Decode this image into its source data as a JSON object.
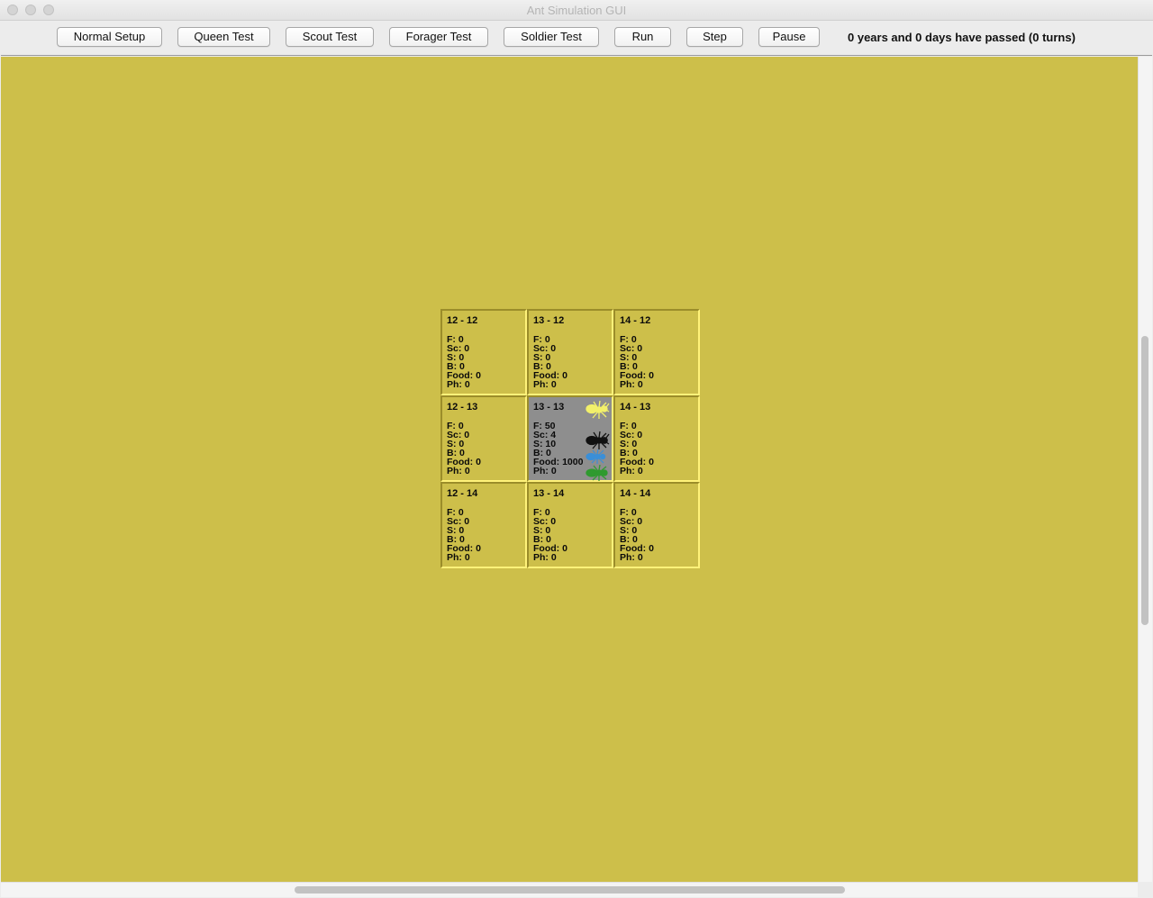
{
  "window": {
    "title": "Ant Simulation GUI"
  },
  "toolbar": {
    "buttons": [
      {
        "label": "Normal Setup"
      },
      {
        "label": "Queen Test"
      },
      {
        "label": "Scout Test"
      },
      {
        "label": "Forager Test"
      },
      {
        "label": "Soldier Test"
      },
      {
        "label": "Run"
      },
      {
        "label": "Step"
      },
      {
        "label": "Pause"
      }
    ],
    "status": "0 years and 0 days have passed (0 turns)"
  },
  "colors": {
    "field": "#cdbf4a",
    "colony_cell": "#8e8e8e",
    "queen_ant": "#f2f06a",
    "soldier_ant": "#111111",
    "scout_ant": "#3a8fd8",
    "forager_ant": "#2f9a2f"
  },
  "grid": {
    "cells": [
      {
        "title": "12 - 12",
        "f": "F: 0",
        "sc": "Sc: 0",
        "s": "S: 0",
        "b": "B: 0",
        "food": "Food: 0",
        "ph": "Ph: 0"
      },
      {
        "title": "13 - 12",
        "f": "F: 0",
        "sc": "Sc: 0",
        "s": "S: 0",
        "b": "B: 0",
        "food": "Food: 0",
        "ph": "Ph: 0"
      },
      {
        "title": "14 - 12",
        "f": "F: 0",
        "sc": "Sc: 0",
        "s": "S: 0",
        "b": "B: 0",
        "food": "Food: 0",
        "ph": "Ph: 0"
      },
      {
        "title": "12 - 13",
        "f": "F: 0",
        "sc": "Sc: 0",
        "s": "S: 0",
        "b": "B: 0",
        "food": "Food: 0",
        "ph": "Ph: 0"
      },
      {
        "title": "13 - 13",
        "f": "F: 50",
        "sc": "Sc: 4",
        "s": "S: 10",
        "b": "B: 0",
        "food": "Food: 1000",
        "ph": "Ph: 0"
      },
      {
        "title": "14 - 13",
        "f": "F: 0",
        "sc": "Sc: 0",
        "s": "S: 0",
        "b": "B: 0",
        "food": "Food: 0",
        "ph": "Ph: 0"
      },
      {
        "title": "12 - 14",
        "f": "F: 0",
        "sc": "Sc: 0",
        "s": "S: 0",
        "b": "B: 0",
        "food": "Food: 0",
        "ph": "Ph: 0"
      },
      {
        "title": "13 - 14",
        "f": "F: 0",
        "sc": "Sc: 0",
        "s": "S: 0",
        "b": "B: 0",
        "food": "Food: 0",
        "ph": "Ph: 0"
      },
      {
        "title": "14 - 14",
        "f": "F: 0",
        "sc": "Sc: 0",
        "s": "S: 0",
        "b": "B: 0",
        "food": "Food: 0",
        "ph": "Ph: 0"
      }
    ],
    "colony_icons": [
      "queen-ant-icon",
      "soldier-ant-icon",
      "scout-ant-icon",
      "forager-ant-icon"
    ]
  }
}
